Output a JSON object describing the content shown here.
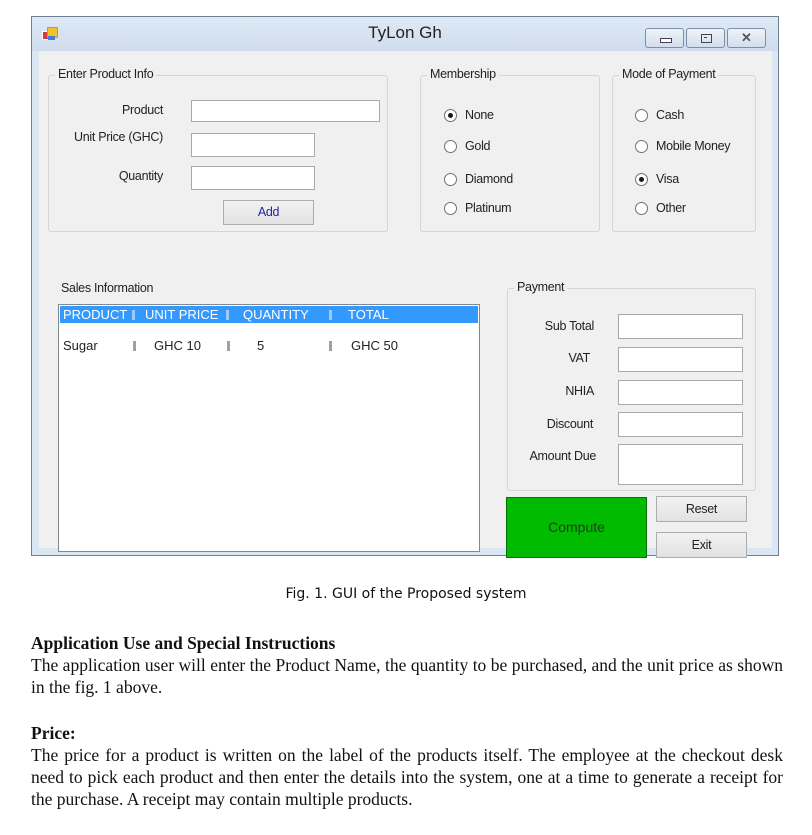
{
  "window": {
    "title": "TyLon Gh",
    "icon": "app-icon",
    "controls": {
      "minimize": "minimize-icon",
      "maximize": "maximize-icon",
      "close": "✕"
    }
  },
  "product_info": {
    "group_label": "Enter Product Info",
    "product_label": "Product",
    "product_value": "",
    "unit_price_label": "Unit Price (GHC)",
    "unit_price_value": "",
    "quantity_label": "Quantity",
    "quantity_value": "",
    "add_button": "Add"
  },
  "membership": {
    "group_label": "Membership",
    "options": [
      "None",
      "Gold",
      "Diamond",
      "Platinum"
    ],
    "selected": "None"
  },
  "payment_mode": {
    "group_label": "Mode of Payment",
    "options": [
      "Cash",
      "Mobile Money",
      "Visa",
      "Other"
    ],
    "selected": "Visa"
  },
  "sales": {
    "label": "Sales Information",
    "columns": [
      "PRODUCT",
      "UNIT PRICE",
      "QUANTITY",
      "TOTAL"
    ],
    "rows": [
      {
        "product": "Sugar",
        "unit_price": "GHC 10",
        "quantity": "5",
        "total": "GHC 50"
      }
    ]
  },
  "payment": {
    "group_label": "Payment",
    "fields": [
      {
        "label": "Sub Total",
        "value": ""
      },
      {
        "label": "VAT",
        "value": ""
      },
      {
        "label": "NHIA",
        "value": ""
      },
      {
        "label": "Discount",
        "value": ""
      },
      {
        "label": "Amount Due",
        "value": ""
      }
    ],
    "compute_button": "Compute",
    "reset_button": "Reset",
    "exit_button": "Exit",
    "compute_color": "#00bb00"
  },
  "document": {
    "caption": "Fig. 1. GUI of the Proposed system",
    "section1_heading": "Application Use and Special Instructions",
    "section1_body": "The application user will enter the Product Name, the quantity to be purchased, and the unit price as shown in the fig. 1 above.",
    "section2_heading": "Price:",
    "section2_body": "The price for a product is written on the label of the products itself. The employee at the checkout desk need to pick each product and then enter the details into the system, one at a time to generate a receipt for the purchase. A receipt may contain multiple products."
  }
}
